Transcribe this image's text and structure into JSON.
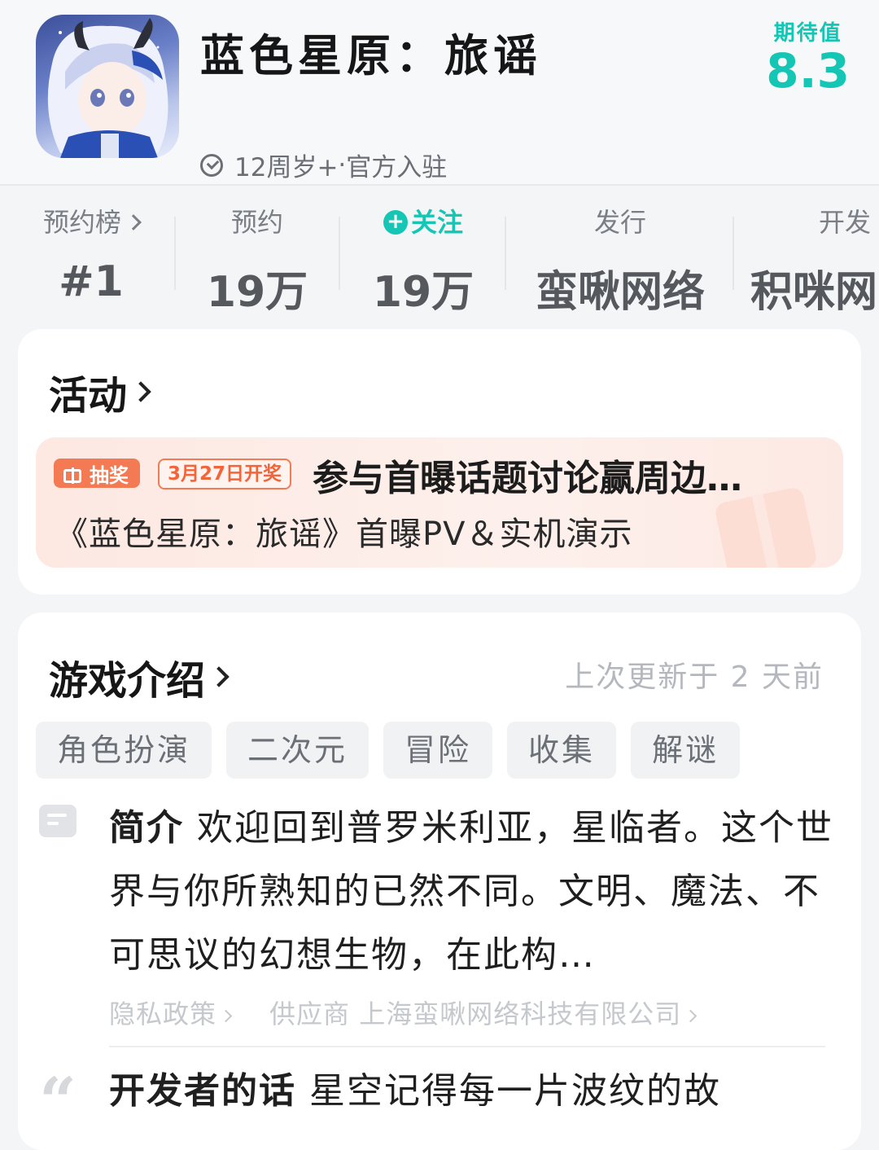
{
  "header": {
    "title": "蓝色星原：旅谣",
    "age_rating": "12周岁+",
    "separator": "·",
    "official": "官方入驻",
    "expectation_label": "期待值",
    "expectation_value": "8.3"
  },
  "stats": [
    {
      "label": "预约榜",
      "value": "#1"
    },
    {
      "label": "预约",
      "value": "19万"
    },
    {
      "label": "关注",
      "value": "19万"
    },
    {
      "label": "发行",
      "value": "蛮啾网络"
    },
    {
      "label": "开发",
      "value": "积咪网"
    }
  ],
  "activity": {
    "title": "活动",
    "badge": "抽奖",
    "date_badge": "3月27日开奖",
    "event_title": "参与首曝话题讨论赢周边…",
    "event_subtitle": "《蓝色星原：旅谣》首曝PV＆实机演示"
  },
  "intro": {
    "title": "游戏介绍",
    "updated": "上次更新于 2 天前",
    "tags": [
      "角色扮演",
      "二次元",
      "冒险",
      "收集",
      "解谜"
    ],
    "summary_label": "简介",
    "summary_text": " 欢迎回到普罗米利亚，星临者。这个世界与你所熟知的已然不同。文明、魔法、不可思议的幻想生物，在此构…",
    "privacy_link": "隐私政策",
    "supplier_link": "供应商 上海蛮啾网络科技有限公司",
    "dev_words_label": "开发者的话",
    "dev_words_text": " 星空记得每一片波纹的故"
  }
}
